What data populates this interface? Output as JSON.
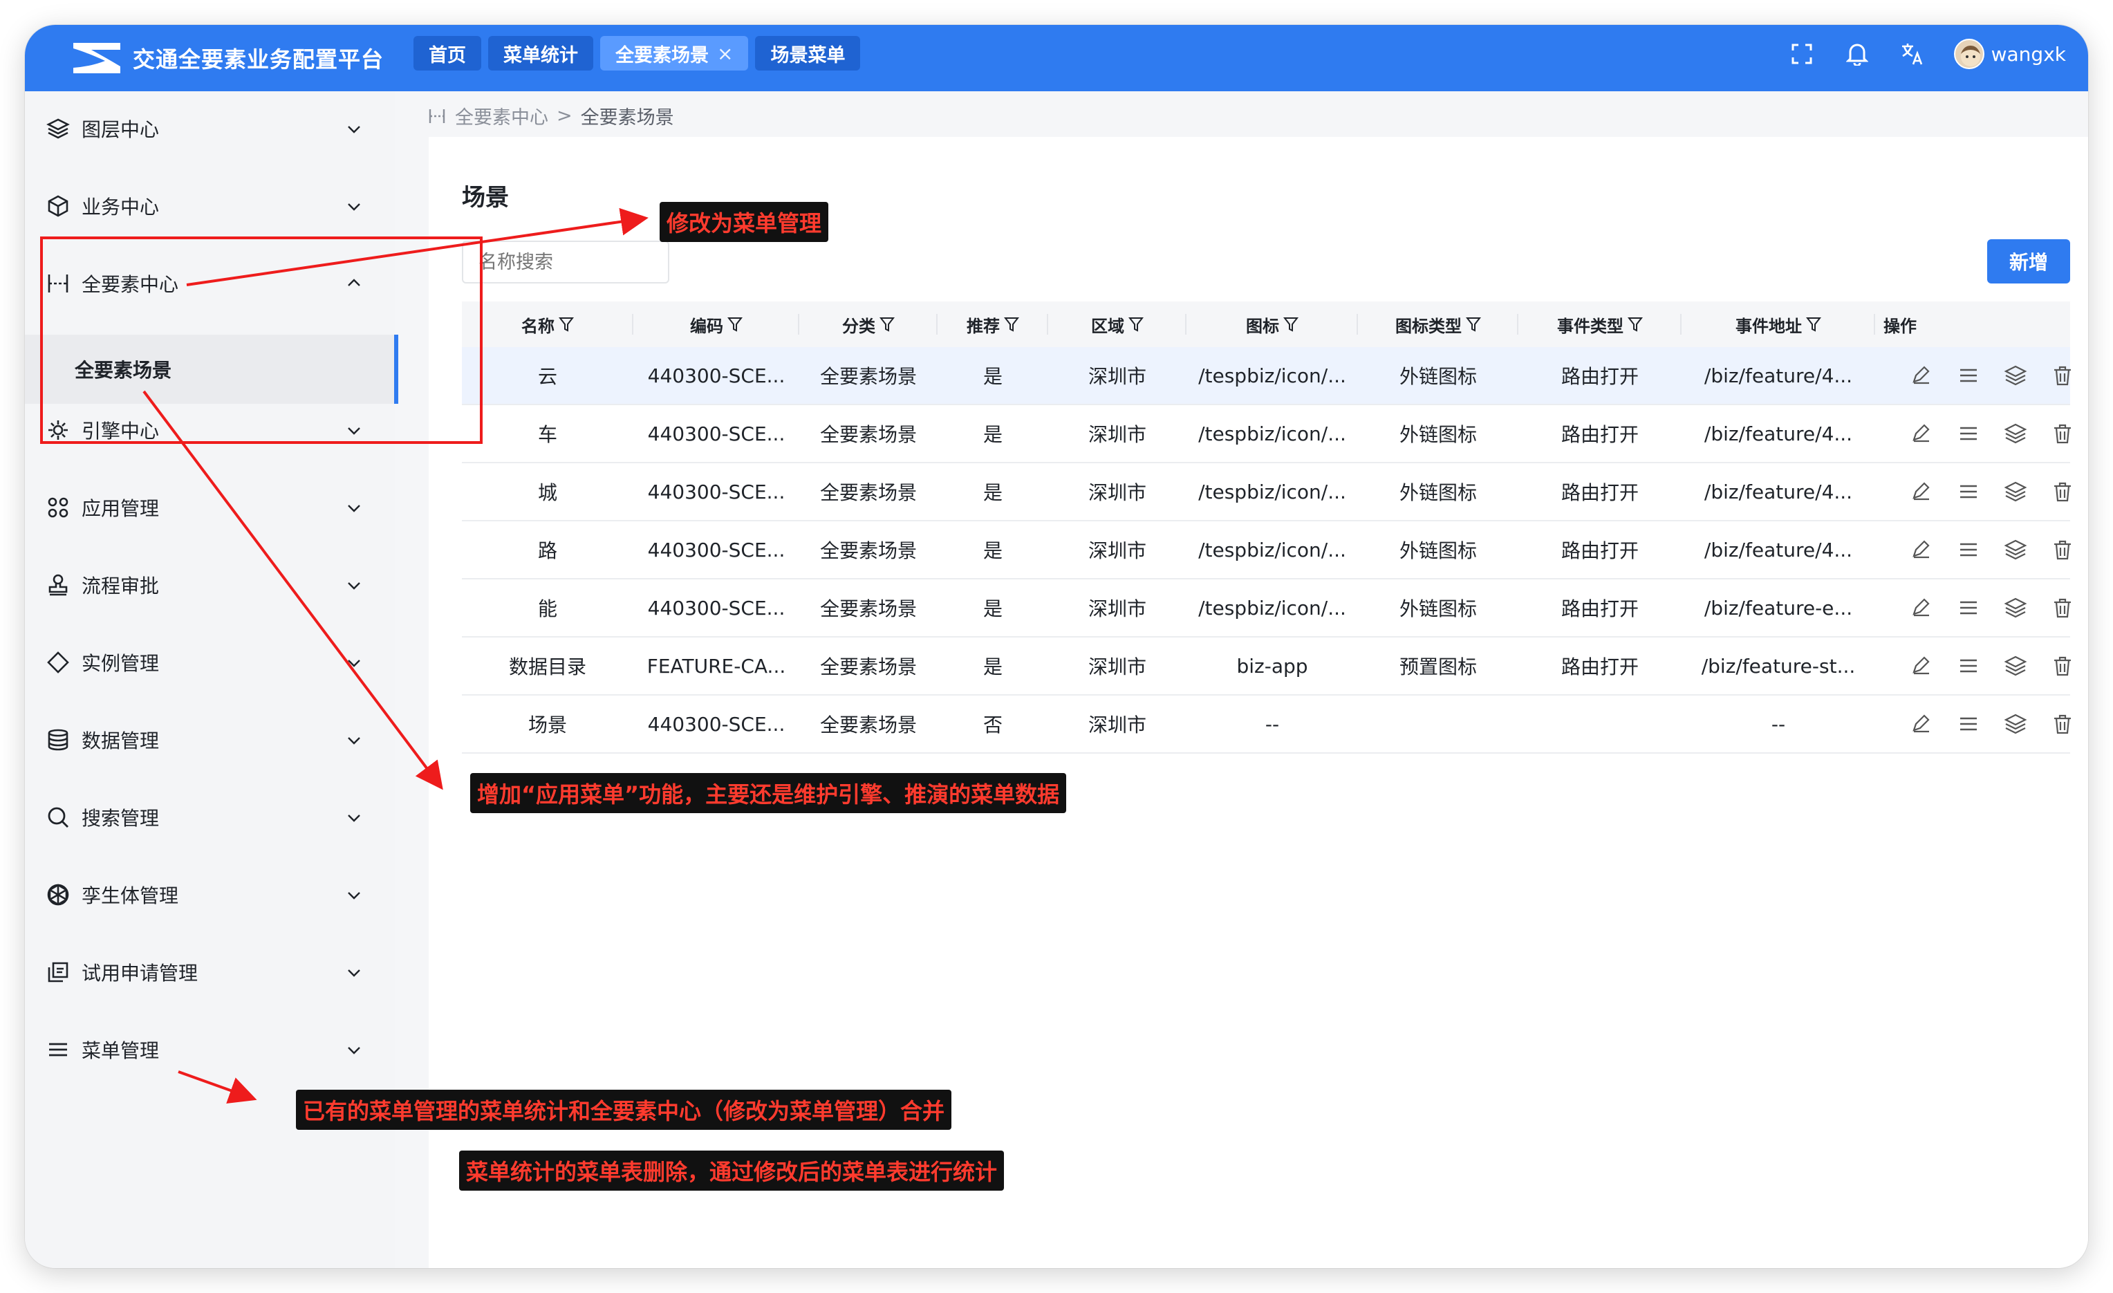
{
  "app": {
    "title": "交通全要素业务配置平台"
  },
  "tabs": [
    {
      "label": "首页"
    },
    {
      "label": "菜单统计"
    },
    {
      "label": "全要素场景",
      "close": "×"
    },
    {
      "label": "场景菜单"
    }
  ],
  "header": {
    "username": "wangxk"
  },
  "sidebar": {
    "items": [
      {
        "label": "图层中心",
        "icon": "layers-icon"
      },
      {
        "label": "业务中心",
        "icon": "cube-icon"
      },
      {
        "label": "全要素中心",
        "icon": "element-icon"
      },
      {
        "label": "引擎中心",
        "icon": "engine-icon"
      },
      {
        "label": "应用管理",
        "icon": "apps-icon"
      },
      {
        "label": "流程审批",
        "icon": "stamp-icon"
      },
      {
        "label": "实例管理",
        "icon": "diamond-icon"
      },
      {
        "label": "数据管理",
        "icon": "database-icon"
      },
      {
        "label": "搜索管理",
        "icon": "search-icon"
      },
      {
        "label": "孪生体管理",
        "icon": "twin-icon"
      },
      {
        "label": "试用申请管理",
        "icon": "apply-icon"
      },
      {
        "label": "菜单管理",
        "icon": "menu-icon"
      }
    ],
    "sub_item": "全要素场景"
  },
  "breadcrumb": {
    "parent": "全要素中心",
    "sep": ">",
    "current": "全要素场景"
  },
  "page": {
    "title": "场景",
    "search_placeholder": "名称搜索",
    "add_label": "新增"
  },
  "table": {
    "columns": [
      "名称",
      "编码",
      "分类",
      "推荐",
      "区域",
      "图标",
      "图标类型",
      "事件类型",
      "事件地址",
      "操作"
    ],
    "rows": [
      [
        "云",
        "440300-SCE...",
        "全要素场景",
        "是",
        "深圳市",
        "/tespbiz/icon/...",
        "外链图标",
        "路由打开",
        "/biz/feature/4..."
      ],
      [
        "车",
        "440300-SCE...",
        "全要素场景",
        "是",
        "深圳市",
        "/tespbiz/icon/...",
        "外链图标",
        "路由打开",
        "/biz/feature/4..."
      ],
      [
        "城",
        "440300-SCE...",
        "全要素场景",
        "是",
        "深圳市",
        "/tespbiz/icon/...",
        "外链图标",
        "路由打开",
        "/biz/feature/4..."
      ],
      [
        "路",
        "440300-SCE...",
        "全要素场景",
        "是",
        "深圳市",
        "/tespbiz/icon/...",
        "外链图标",
        "路由打开",
        "/biz/feature/4..."
      ],
      [
        "能",
        "440300-SCE...",
        "全要素场景",
        "是",
        "深圳市",
        "/tespbiz/icon/...",
        "外链图标",
        "路由打开",
        "/biz/feature-e..."
      ],
      [
        "数据目录",
        "FEATURE-CA...",
        "全要素场景",
        "是",
        "深圳市",
        "biz-app",
        "预置图标",
        "路由打开",
        "/biz/feature-st..."
      ],
      [
        "场景",
        "440300-SCE...",
        "全要素场景",
        "否",
        "深圳市",
        "--",
        "",
        "",
        "--"
      ]
    ]
  },
  "annotations": {
    "note1": "修改为菜单管理",
    "note2": "增加“应用菜单”功能，主要还是维护引擎、推演的菜单数据",
    "note3": "已有的菜单管理的菜单统计和全要素中心（修改为菜单管理）合并",
    "note4": "菜单统计的菜单表删除，通过修改后的菜单表进行统计"
  },
  "colors": {
    "primary": "#2f7bf0",
    "annotation": "#ee1c1c",
    "note_bg": "#111111",
    "note_text": "#ff3b2e"
  }
}
